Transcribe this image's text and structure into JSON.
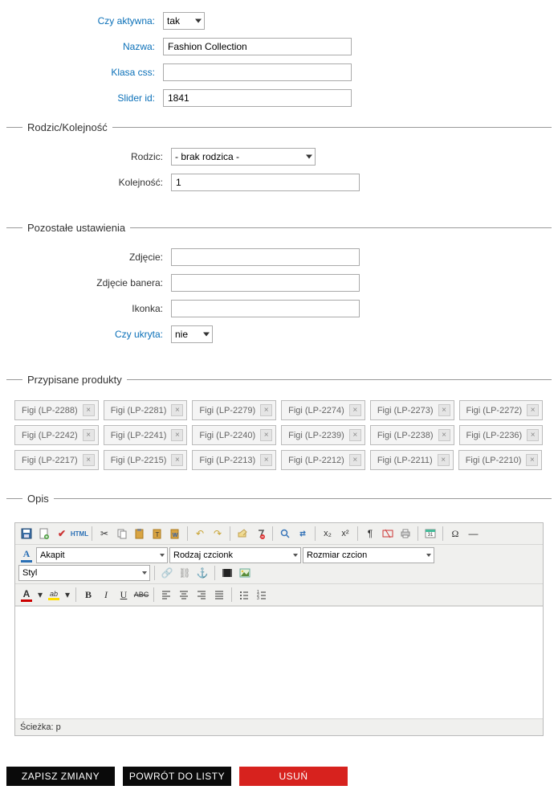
{
  "top": {
    "aktywna_label": "Czy aktywna:",
    "aktywna_value": "tak",
    "nazwa_label": "Nazwa:",
    "nazwa_value": "Fashion Collection",
    "klasa_label": "Klasa css:",
    "klasa_value": "",
    "slider_label": "Slider id:",
    "slider_value": "1841"
  },
  "parent_section": {
    "legend": "Rodzic/Kolejność",
    "rodzic_label": "Rodzic:",
    "rodzic_value": "- brak rodzica -",
    "kolejnosc_label": "Kolejność:",
    "kolejnosc_value": "1"
  },
  "other_section": {
    "legend": "Pozostałe ustawienia",
    "zdjecie_label": "Zdjęcie:",
    "zdjecie_value": "",
    "baner_label": "Zdjęcie banera:",
    "baner_value": "",
    "ikonka_label": "Ikonka:",
    "ikonka_value": "",
    "ukryta_label": "Czy ukryta:",
    "ukryta_value": "nie"
  },
  "products_section": {
    "legend": "Przypisane produkty",
    "items": [
      {
        "label": "Figi (LP-2288)"
      },
      {
        "label": "Figi (LP-2281)"
      },
      {
        "label": "Figi (LP-2279)"
      },
      {
        "label": "Figi (LP-2274)"
      },
      {
        "label": "Figi (LP-2273)"
      },
      {
        "label": "Figi (LP-2272)"
      },
      {
        "label": "Figi (LP-2242)"
      },
      {
        "label": "Figi (LP-2241)"
      },
      {
        "label": "Figi (LP-2240)"
      },
      {
        "label": "Figi (LP-2239)"
      },
      {
        "label": "Figi (LP-2238)"
      },
      {
        "label": "Figi (LP-2236)"
      },
      {
        "label": "Figi (LP-2217)"
      },
      {
        "label": "Figi (LP-2215)"
      },
      {
        "label": "Figi (LP-2213)"
      },
      {
        "label": "Figi (LP-2212)"
      },
      {
        "label": "Figi (LP-2211)"
      },
      {
        "label": "Figi (LP-2210)"
      }
    ]
  },
  "opis_section": {
    "legend": "Opis",
    "format_value": "Akapit",
    "fontfamily_value": "Rodzaj czcionk",
    "fontsize_value": "Rozmiar czcion",
    "style_value": "Styl",
    "path_label": "Ścieżka: p"
  },
  "actions": {
    "save": "ZAPISZ ZMIANY",
    "back": "POWRÓT DO LISTY",
    "delete": "USUŃ"
  }
}
